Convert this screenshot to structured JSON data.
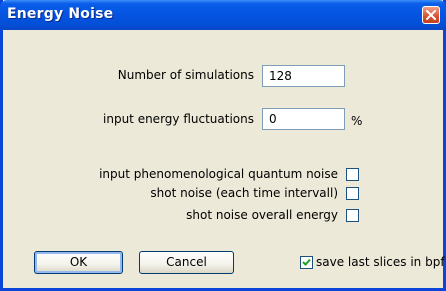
{
  "window": {
    "title": "Energy Noise"
  },
  "fields": {
    "num_sims_label": "Number of simulations",
    "num_sims_value": "128",
    "energy_fluct_label": "input energy fluctuations",
    "energy_fluct_value": "0",
    "energy_fluct_unit": "%"
  },
  "checkboxes": [
    {
      "label": "input phenomenological quantum noise",
      "checked": false
    },
    {
      "label": "shot noise (each time intervall)",
      "checked": false
    },
    {
      "label": "shot noise overall energy",
      "checked": false
    }
  ],
  "buttons": {
    "ok": "OK",
    "cancel": "Cancel"
  },
  "save_option": {
    "label": "save last slices in bpf",
    "checked": true
  },
  "colors": {
    "titlebar": "#0454e1",
    "dialog_bg": "#ece9d8",
    "field_border": "#7f9db9",
    "check_mark": "#21a121"
  }
}
